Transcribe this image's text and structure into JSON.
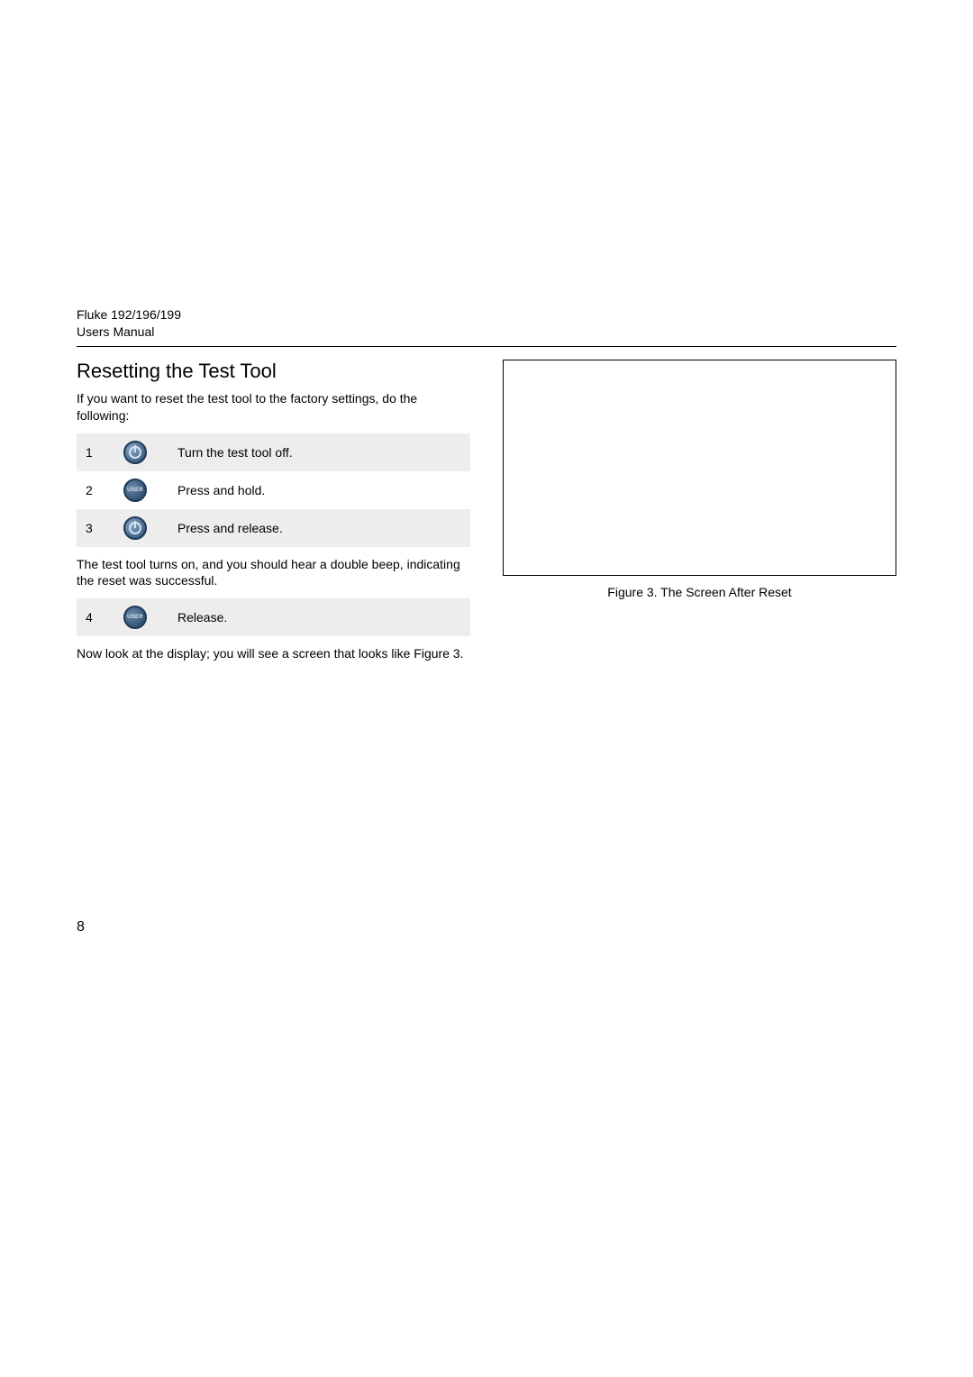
{
  "header": {
    "line1": "Fluke 192/196/199",
    "line2": "Users Manual"
  },
  "left": {
    "section_title": "Resetting the Test Tool",
    "intro": "If you want to reset the test tool to the factory settings, do the following:",
    "steps_a": [
      {
        "num": "1",
        "icon": "power",
        "text": "Turn the test tool off."
      },
      {
        "num": "2",
        "icon": "user",
        "text": "Press and hold."
      },
      {
        "num": "3",
        "icon": "power",
        "text": "Press and release."
      }
    ],
    "mid_text": "The test tool turns on, and you should hear a double beep, indicating the reset was successful.",
    "steps_b": [
      {
        "num": "4",
        "icon": "user",
        "text": "Release."
      }
    ],
    "outro": "Now look at the display; you will see a screen that looks like Figure 3."
  },
  "right": {
    "figure_caption": "Figure 3. The Screen After Reset"
  },
  "page_number": "8",
  "icons": {
    "power_label": "power-icon",
    "user_label": "USER"
  }
}
